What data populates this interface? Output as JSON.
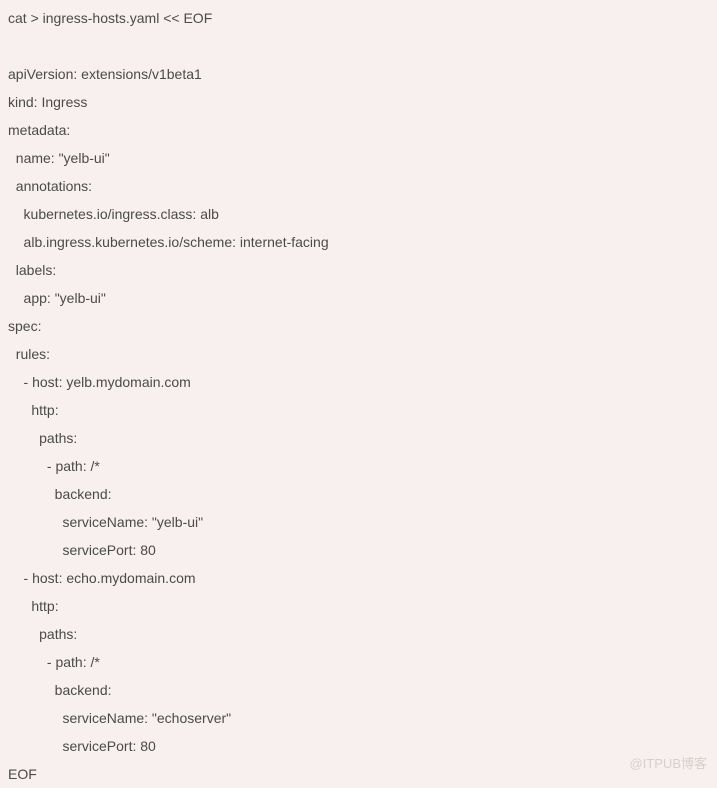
{
  "code": {
    "lines": [
      "cat > ingress-hosts.yaml << EOF",
      "",
      "apiVersion: extensions/v1beta1",
      "kind: Ingress",
      "metadata:",
      "  name: \"yelb-ui\"",
      "  annotations:",
      "    kubernetes.io/ingress.class: alb",
      "    alb.ingress.kubernetes.io/scheme: internet-facing",
      "  labels:",
      "    app: \"yelb-ui\"",
      "spec:",
      "  rules:",
      "    - host: yelb.mydomain.com",
      "      http:",
      "        paths:",
      "          - path: /*",
      "            backend:",
      "              serviceName: \"yelb-ui\"",
      "              servicePort: 80",
      "    - host: echo.mydomain.com",
      "      http:",
      "        paths:",
      "          - path: /*",
      "            backend:",
      "              serviceName: \"echoserver\"",
      "              servicePort: 80",
      "EOF"
    ]
  },
  "watermark": "@ITPUB博客"
}
